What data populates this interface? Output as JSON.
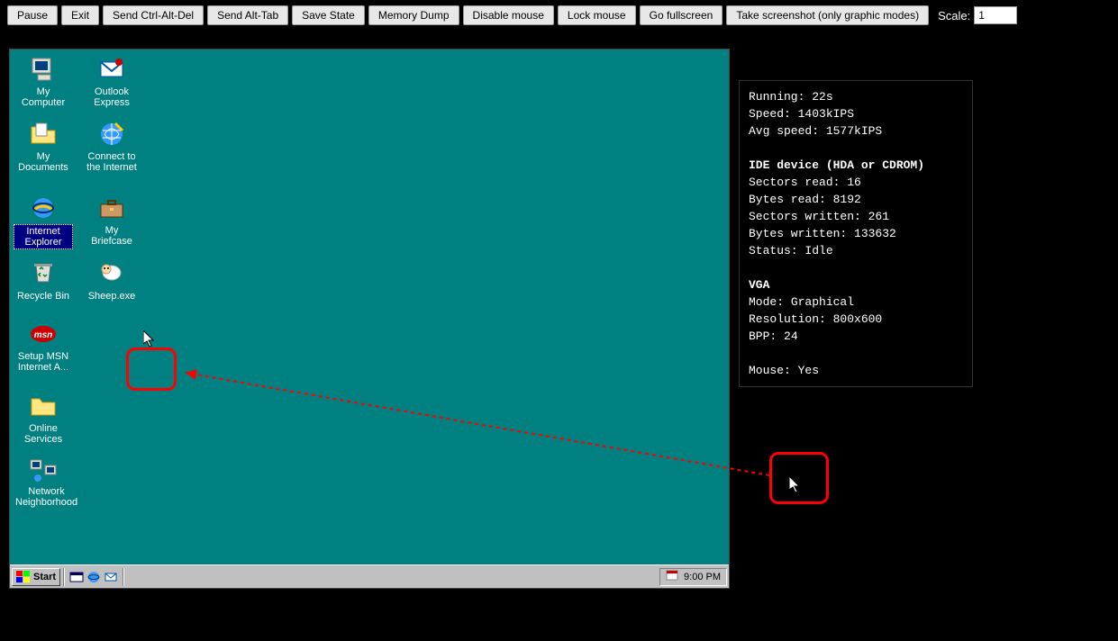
{
  "toolbar": {
    "pause": "Pause",
    "exit": "Exit",
    "ctrl_alt_del": "Send Ctrl-Alt-Del",
    "alt_tab": "Send Alt-Tab",
    "save_state": "Save State",
    "memory_dump": "Memory Dump",
    "disable_mouse": "Disable mouse",
    "lock_mouse": "Lock mouse",
    "fullscreen": "Go fullscreen",
    "screenshot": "Take screenshot (only graphic modes)",
    "scale_label": "Scale:",
    "scale_value": "1"
  },
  "desktop": {
    "icons": {
      "my_computer": "My Computer",
      "outlook_express": "Outlook Express",
      "my_documents": "My Documents",
      "connect_internet": "Connect to the Internet",
      "internet_explorer": "Internet Explorer",
      "my_briefcase": "My Briefcase",
      "recycle_bin": "Recycle Bin",
      "sheep": "Sheep.exe",
      "setup_msn": "Setup MSN Internet A...",
      "online_services": "Online Services",
      "network_neighborhood": "Network Neighborhood"
    }
  },
  "taskbar": {
    "start": "Start",
    "time": "9:00 PM"
  },
  "status": {
    "running_label": "Running: ",
    "running_value": "22s",
    "speed_label": "Speed: ",
    "speed_value": "1403kIPS",
    "avg_speed_label": "Avg speed: ",
    "avg_speed_value": "1577kIPS",
    "ide_header": "IDE device (HDA or CDROM)",
    "sectors_read_label": "Sectors read: ",
    "sectors_read_value": "16",
    "bytes_read_label": "Bytes read: ",
    "bytes_read_value": "8192",
    "sectors_written_label": "Sectors written: ",
    "sectors_written_value": "261",
    "bytes_written_label": "Bytes written: ",
    "bytes_written_value": "133632",
    "status_label": "Status: ",
    "status_value": "Idle",
    "vga_header": "VGA",
    "mode_label": "Mode: ",
    "mode_value": "Graphical",
    "resolution_label": "Resolution: ",
    "resolution_value": "800x600",
    "bpp_label": "BPP: ",
    "bpp_value": "24",
    "mouse_label": "Mouse: ",
    "mouse_value": "Yes"
  }
}
